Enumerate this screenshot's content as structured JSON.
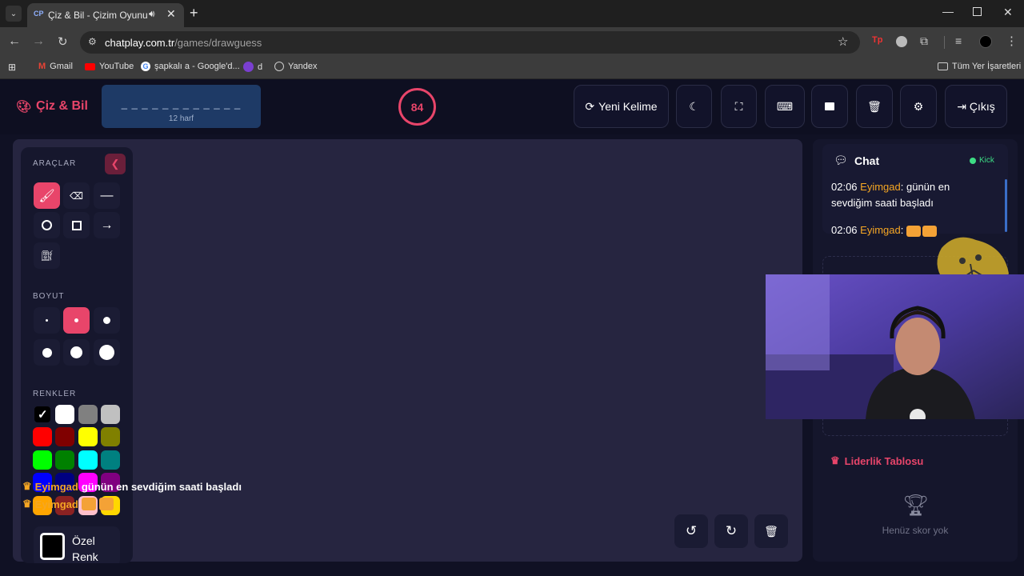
{
  "browser": {
    "tab_title": "Çiz & Bil - Çizim Oyunu",
    "tab_favicon": "CP",
    "url_host": "chatplay.com.tr",
    "url_path": "/games/drawguess",
    "bookmarks": [
      "Gmail",
      "YouTube",
      "şapkalı a - Google'd...",
      "d",
      "Yandex"
    ],
    "all_bookmarks": "Tüm Yer İşaretleri"
  },
  "header": {
    "logo": "Çiz & Bil",
    "word_mask": "_ _ _ _ _ _ _ _ _ _ _ _",
    "word_hint": "12 harf",
    "timer": "84",
    "new_word": "Yeni Kelime",
    "logout": "Çıkış"
  },
  "tools": {
    "section_tools": "ARAÇLAR",
    "section_size": "BOYUT",
    "section_colors": "RENKLER",
    "custom_color_line1": "Özel",
    "custom_color_line2": "Renk",
    "colors": [
      "#000000",
      "#ffffff",
      "#808080",
      "#c0c0c0",
      "#ff0000",
      "#800000",
      "#ffff00",
      "#808000",
      "#00ff00",
      "#008000",
      "#00ffff",
      "#008080",
      "#0000ff",
      "#000080",
      "#ff00ff",
      "#800080",
      "#ffa500",
      "#8b2222",
      "#ffc0cb",
      "#ffd700"
    ]
  },
  "chat": {
    "title": "Chat",
    "kick": "Kick",
    "messages": [
      {
        "time": "02:06",
        "user": "Eyimgad",
        "text": "günün en sevdiğim saati başladı"
      },
      {
        "time": "02:06",
        "user": "Eyimgad",
        "text": ""
      }
    ],
    "leaderboard_title": "Liderlik Tablosu",
    "leaderboard_empty": "Henüz skor yok"
  },
  "overlay": {
    "user1": "Eyimgad",
    "msg1": "günün en sevdiğim saati başladı",
    "user2": "Eyimgad"
  },
  "accent": "#e8456a"
}
